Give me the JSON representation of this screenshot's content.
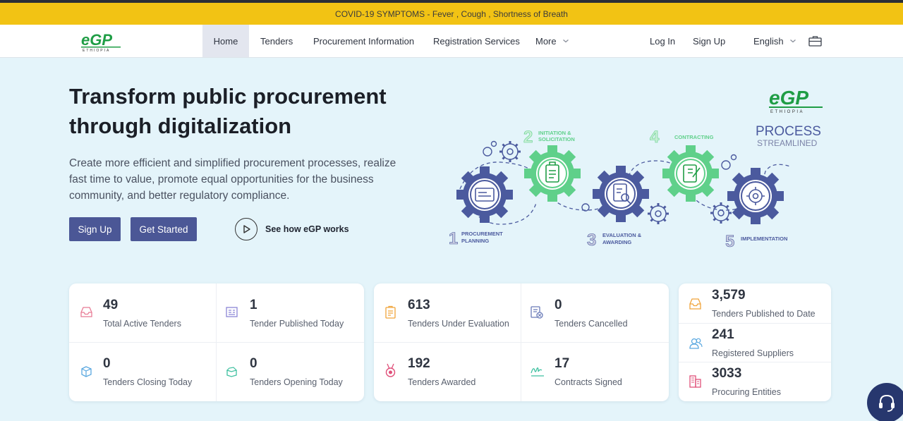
{
  "banner": {
    "text": "COVID-19 SYMPTOMS - Fever , Cough , Shortness of Breath"
  },
  "brand": {
    "logo_text": "eGP",
    "logo_subtext": "ETHIOPIA"
  },
  "nav": {
    "items": [
      {
        "label": "Home",
        "active": true
      },
      {
        "label": "Tenders"
      },
      {
        "label": "Procurement Information"
      },
      {
        "label": "Registration Services"
      },
      {
        "label": "More"
      }
    ],
    "login": "Log In",
    "signup": "Sign Up",
    "language": "English",
    "icons": {
      "language_caret": "chevron-down-icon",
      "more_caret": "chevron-down-icon",
      "briefcase": "briefcase-icon"
    }
  },
  "hero": {
    "title": "Transform public procurement through digitalization",
    "description": "Create more efficient and simplified procurement processes, realize fast time to value, promote equal opportunities for the business community, and better regulatory compliance.",
    "signup_button": "Sign Up",
    "get_started_button": "Get Started",
    "how_link": "See how eGP works"
  },
  "process": {
    "title": "PROCESS",
    "subtitle": "STREAMLINED",
    "steps": [
      {
        "num": "1",
        "label_1": "PROCUREMENT",
        "label_2": "PLANNING"
      },
      {
        "num": "2",
        "label_1": "INITIATION &",
        "label_2": "SOLICITATION"
      },
      {
        "num": "3",
        "label_1": "EVALUATION &",
        "label_2": "AWARDING"
      },
      {
        "num": "4",
        "label_1": "CONTRACTING",
        "label_2": ""
      },
      {
        "num": "5",
        "label_1": "IMPLEMENTATION",
        "label_2": ""
      }
    ]
  },
  "stats": {
    "total_active_tenders": {
      "value": "49",
      "label": "Total Active Tenders"
    },
    "tender_published_today": {
      "value": "1",
      "label": "Tender Published Today"
    },
    "tenders_closing_today": {
      "value": "0",
      "label": "Tenders Closing Today"
    },
    "tenders_opening_today": {
      "value": "0",
      "label": "Tenders Opening Today"
    },
    "tenders_under_evaluation": {
      "value": "613",
      "label": "Tenders Under Evaluation"
    },
    "tenders_cancelled": {
      "value": "0",
      "label": "Tenders Cancelled"
    },
    "tenders_awarded": {
      "value": "192",
      "label": "Tenders Awarded"
    },
    "contracts_signed": {
      "value": "17",
      "label": "Contracts Signed"
    },
    "tenders_published_to_date": {
      "value": "3,579",
      "label": "Tenders Published to Date"
    },
    "registered_suppliers": {
      "value": "241",
      "label": "Registered Suppliers"
    },
    "procuring_entities": {
      "value": "3033",
      "label": "Procuring Entities"
    }
  },
  "colors": {
    "banner": "#f2c314",
    "primary_button": "#4b5796",
    "hero_bg": "#e4f4fa",
    "gear_blue": "#4b5a9e",
    "gear_green": "#5fd08a",
    "brand_green": "#1f9d45",
    "support_button": "#27376e"
  }
}
